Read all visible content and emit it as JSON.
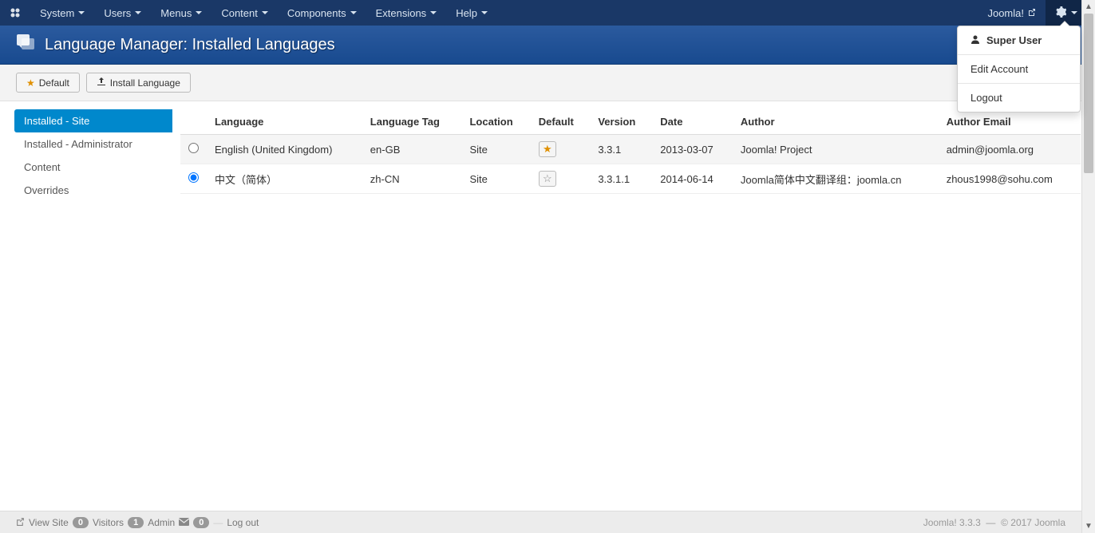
{
  "nav": {
    "items": [
      "System",
      "Users",
      "Menus",
      "Content",
      "Components",
      "Extensions",
      "Help"
    ],
    "brand": "Joomla!"
  },
  "header": {
    "title": "Language Manager: Installed Languages"
  },
  "toolbar": {
    "default": "Default",
    "install": "Install Language"
  },
  "sidebar": {
    "items": [
      "Installed - Site",
      "Installed - Administrator",
      "Content",
      "Overrides"
    ]
  },
  "table": {
    "headers": {
      "language": "Language",
      "tag": "Language Tag",
      "location": "Location",
      "default": "Default",
      "version": "Version",
      "date": "Date",
      "author": "Author",
      "email": "Author Email"
    },
    "rows": [
      {
        "language": "English (United Kingdom)",
        "tag": "en-GB",
        "location": "Site",
        "default": true,
        "version": "3.3.1",
        "date": "2013-03-07",
        "author": "Joomla! Project",
        "email": "admin@joomla.org",
        "selected": false
      },
      {
        "language": "中文（简体）",
        "tag": "zh-CN",
        "location": "Site",
        "default": false,
        "version": "3.3.1.1",
        "date": "2014-06-14",
        "author": "Joomla简体中文翻译组：joomla.cn",
        "email": "zhous1998@sohu.com",
        "selected": true
      }
    ]
  },
  "user_menu": {
    "user": "Super User",
    "edit": "Edit Account",
    "logout": "Logout"
  },
  "footer": {
    "view_site": "View Site",
    "visitors_count": "0",
    "visitors": "Visitors",
    "admin_count": "1",
    "admin": "Admin",
    "msg_count": "0",
    "logout": "Log out",
    "version": "Joomla! 3.3.3",
    "copyright": "© 2017 Joomla"
  }
}
